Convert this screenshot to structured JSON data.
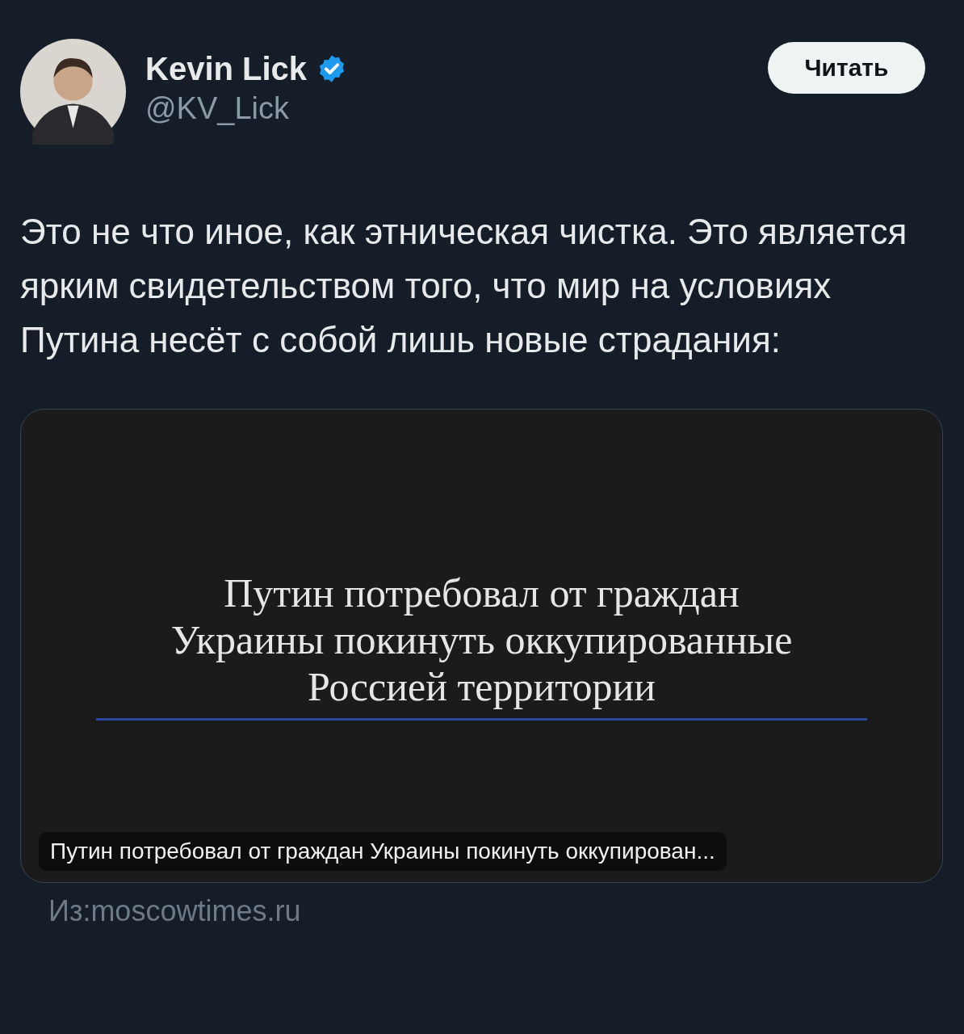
{
  "author": {
    "name": "Kevin Lick",
    "handle": "@KV_Lick",
    "verified": true
  },
  "follow_button": "Читать",
  "text": "Это не что иное, как этническая чистка. Это является ярким свидетельством того, что мир на условиях Путина несёт с собой лишь новые страдания:",
  "card": {
    "image_headline": [
      "Путин потребовал от граждан",
      "Украины покинуть оккупированные",
      "Россией территории"
    ],
    "caption": "Путин потребовал от граждан Украины покинуть оккупирован..."
  },
  "source": "Из:moscowtimes.ru"
}
